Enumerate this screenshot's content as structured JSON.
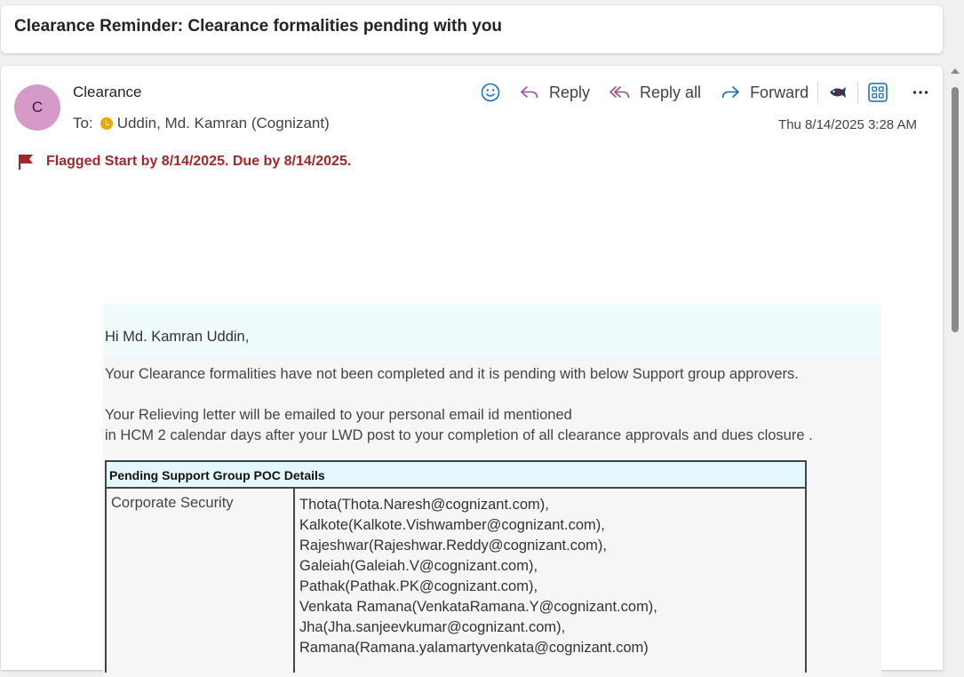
{
  "subject": "Clearance Reminder: Clearance formalities pending with you",
  "header": {
    "avatar_initial": "C",
    "sender": "Clearance",
    "to_label": "To:",
    "recipient": "Uddin, Md. Kamran (Cognizant)",
    "timestamp": "Thu 8/14/2025 3:28 AM"
  },
  "toolbar": {
    "reply_label": "Reply",
    "reply_all_label": "Reply all",
    "forward_label": "Forward",
    "more_label": "···"
  },
  "flag": {
    "text": "Flagged Start by 8/14/2025. Due by 8/14/2025."
  },
  "body": {
    "greeting": "Hi Md. Kamran Uddin,",
    "line1": "Your Clearance formalities have not been completed and it is pending with below Support group approvers.",
    "line2": "Your Relieving letter will be emailed to your personal email id mentioned",
    "line3": "in HCM 2 calendar days after your LWD post to your completion of all clearance approvals and dues closure ."
  },
  "poc_table": {
    "header": "Pending Support Group POC Details",
    "group": "Corporate Security",
    "contacts": [
      "Thota(Thota.Naresh@cognizant.com),",
      "Kalkote(Kalkote.Vishwamber@cognizant.com),",
      "Rajeshwar(Rajeshwar.Reddy@cognizant.com),",
      "Galeiah(Galeiah.V@cognizant.com),",
      "Pathak(Pathak.PK@cognizant.com),",
      "Venkata Ramana(VenkataRamana.Y@cognizant.com),",
      "Jha(Jha.sanjeevkumar@cognizant.com),",
      "Ramana(Ramana.yalamartyvenkata@cognizant.com)"
    ]
  },
  "icons": [
    "emoji-icon",
    "reply-icon",
    "reply-all-icon",
    "forward-icon",
    "fish-icon",
    "apps-icon",
    "more-icon",
    "flag-icon",
    "presence-away-icon"
  ],
  "colors": {
    "avatar_bg": "#d69ac8",
    "flag_red": "#a4262c",
    "accent_blue": "#0f6cbd",
    "greeting_bg": "#effbfd",
    "table_header_bg": "#e4f7fe"
  }
}
